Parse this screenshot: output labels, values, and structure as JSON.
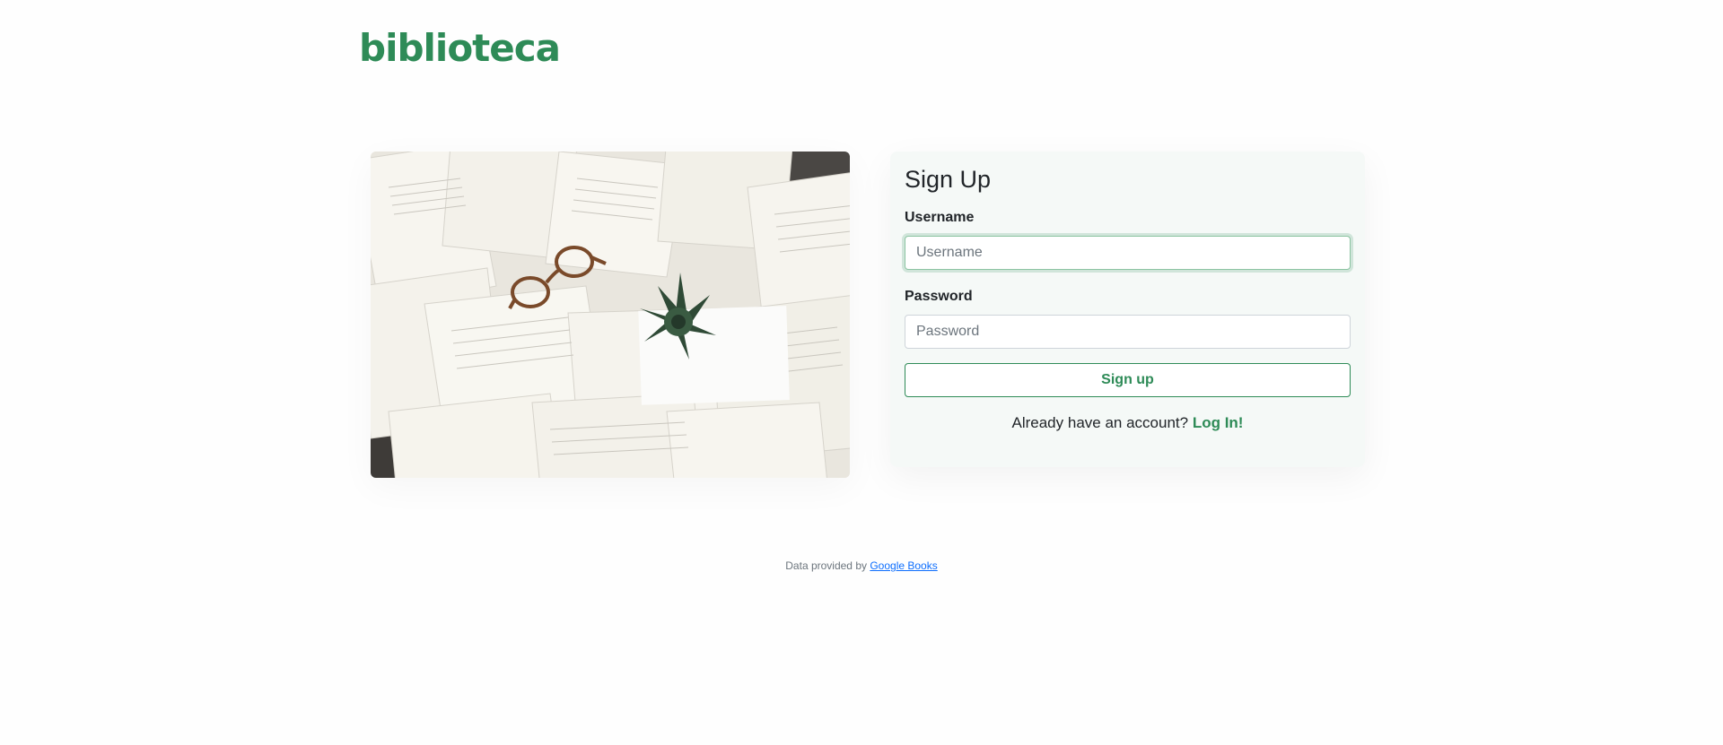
{
  "brand": {
    "logo_text": "biblioteca",
    "color": "#2e8b57"
  },
  "hero": {
    "alt": "Open books on a table with glasses and a small plant"
  },
  "signup": {
    "title": "Sign Up",
    "username_label": "Username",
    "username_placeholder": "Username",
    "username_value": "",
    "password_label": "Password",
    "password_placeholder": "Password",
    "password_value": "",
    "submit_label": "Sign up",
    "already_text": "Already have an account?",
    "login_link": "Log In!"
  },
  "footer": {
    "prefix": "Data provided by",
    "link_text": "Google Books",
    "link_color": "#0d6efd"
  },
  "icons": [
    "book-photo"
  ]
}
